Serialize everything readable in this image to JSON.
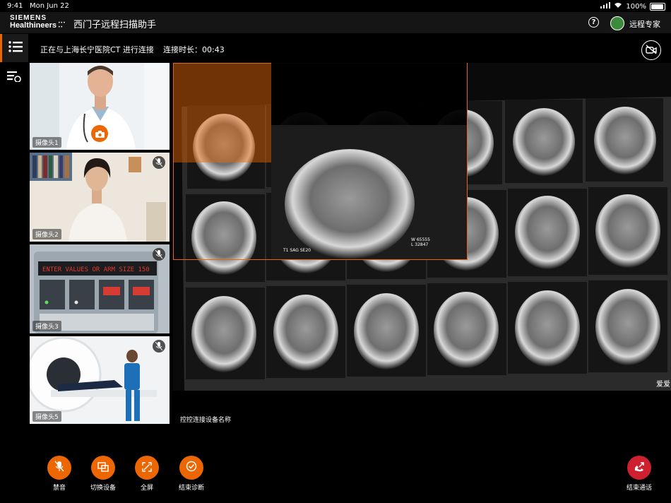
{
  "status_bar": {
    "time": "9:41",
    "date": "Mon Jun 22",
    "battery": "100%"
  },
  "app": {
    "logo_top": "SIEMENS",
    "logo_bottom": "Healthineers",
    "title": "西门子远程扫描助手",
    "user": "远程专家"
  },
  "session": {
    "connection_text": "正在与上海长宁医院CT 进行连接",
    "duration_text": "连接时长：00:43"
  },
  "cameras": [
    {
      "label": "摄像头1",
      "muted": false
    },
    {
      "label": "摄像头2",
      "muted": true
    },
    {
      "label": "摄像头3",
      "muted": true
    },
    {
      "label": "摄像头5",
      "muted": true
    }
  ],
  "device_caption": "控控连接设备名称",
  "controls": [
    {
      "label": "禁音",
      "icon": "mic-mute-icon"
    },
    {
      "label": "切换设备",
      "icon": "switch-device-icon"
    },
    {
      "label": "全屏",
      "icon": "fullscreen-icon"
    },
    {
      "label": "结束诊断",
      "icon": "check-circle-icon"
    }
  ],
  "end_call": {
    "label": "结束通话",
    "icon": "hangup-icon"
  },
  "scan_labels": {
    "zoom_line1": "W 65555",
    "zoom_line2": "L 32847",
    "zoom_series": "T1 SAG SE20",
    "watermark": "爱爱"
  },
  "colors": {
    "accent": "#ec6602",
    "end_call": "#cf2030",
    "background": "#000000"
  }
}
